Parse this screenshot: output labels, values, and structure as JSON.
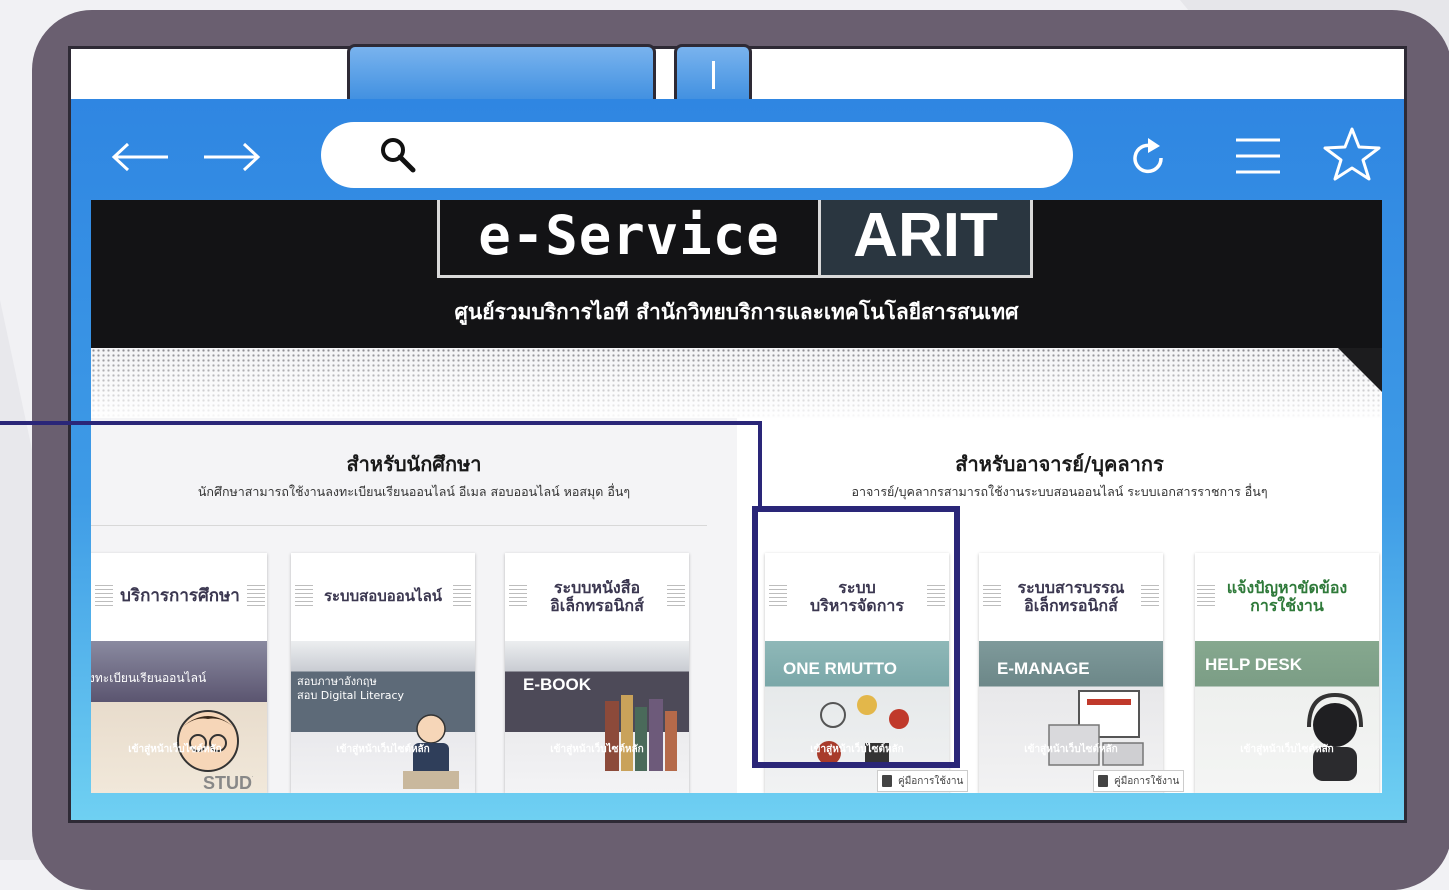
{
  "browser": {
    "back_icon": "arrow-left-icon",
    "forward_icon": "arrow-right-icon",
    "search_icon": "search-icon",
    "reload_icon": "reload-icon",
    "menu_icon": "menu-icon",
    "star_icon": "star-icon",
    "url_value": ""
  },
  "site": {
    "logo_left": "e-Service",
    "logo_right": "ARIT",
    "subtitle": "ศูนย์รวมบริการไอที สำนักวิทยบริการและเทคโนโลยีสารสนเทศ"
  },
  "students": {
    "title": "สำหรับนักศึกษา",
    "description": "นักศึกษาสามารถใช้งานลงทะเบียนเรียนออนไลน์ อีเมล สอบออนไลน์ หอสมุด อื่นๆ",
    "cards": [
      {
        "header": "บริการการศึกษา",
        "image_text": "งทะเบียนเรียนออนไลน์",
        "button": "เข้าสู่หน้าเว็บไซต์หลัก",
        "watermark": "STUDY"
      },
      {
        "header": "ระบบสอบออนไลน์",
        "image_text": "สอบภาษาอังกฤษ\nสอบ Digital Literacy",
        "button": "เข้าสู่หน้าเว็บไซต์หลัก"
      },
      {
        "header": "ระบบหนังสือ\nอิเล็กทรอนิกส์",
        "image_text": "E-BOOK",
        "button": "เข้าสู่หน้าเว็บไซต์หลัก"
      }
    ]
  },
  "staff": {
    "title": "สำหรับอาจารย์/บุคลากร",
    "description": "อาจารย์/บุคลากรสามารถใช้งานระบบสอนออนไลน์ ระบบเอกสารราชการ อื่นๆ",
    "cards": [
      {
        "header": "ระบบ\nบริหารจัดการ",
        "image_text": "ONE RMUTTO",
        "button": "เข้าสู่หน้าเว็บไซต์หลัก",
        "manual": "คู่มือการใช้งาน"
      },
      {
        "header": "ระบบสารบรรณ\nอิเล็กทรอนิกส์",
        "image_text": "E-MANAGE",
        "button": "เข้าสู่หน้าเว็บไซต์หลัก",
        "manual": "คู่มือการใช้งาน"
      },
      {
        "header": "แจ้งปัญหาขัดข้อง\nการใช้งาน",
        "image_text": "HELP DESK",
        "button": "เข้าสู่หน้าเว็บไซต์หลัก"
      }
    ]
  },
  "colors": {
    "frame": "#6a5f70",
    "browser_blue": "#2f86e2",
    "highlight": "#2a2678"
  }
}
